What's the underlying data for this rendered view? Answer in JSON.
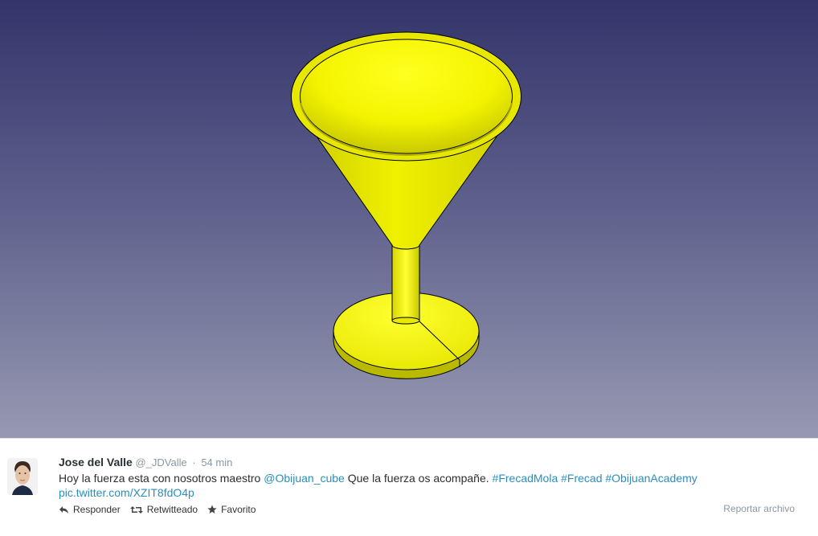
{
  "tweet": {
    "author_name": "Jose del Valle",
    "author_handle": "@_JDValle",
    "separator": "·",
    "time": "54 min",
    "text_prefix": "Hoy la fuerza esta con nosotros maestro ",
    "mention": "@Obijuan_cube",
    "text_middle": " Que la fuerza os acompañe. ",
    "hashtags": [
      "#FrecadMola",
      "#Frecad",
      "#ObijuanAcademy"
    ],
    "pic_link": "pic.twitter.com/XZIT8fdO4p"
  },
  "actions": {
    "reply_label": "Responder",
    "retweet_label": "Retwitteado",
    "favorite_label": "Favorito",
    "report_label": "Reportar archivo"
  },
  "icons": {
    "reply": "reply-icon",
    "retweet": "retweet-icon",
    "favorite": "star-icon"
  },
  "colors": {
    "link": "#2a8fbd",
    "model_yellow": "#ffff00",
    "background_top": "#33346a",
    "background_bottom": "#9799b2"
  }
}
